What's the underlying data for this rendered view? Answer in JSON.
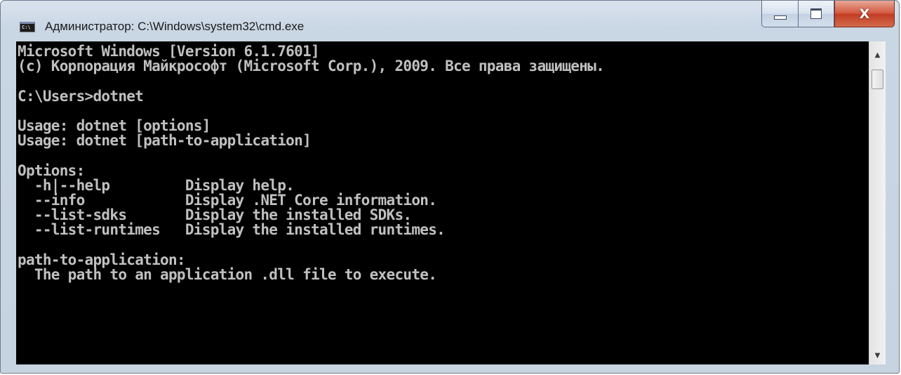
{
  "window": {
    "title": "Администратор: C:\\Windows\\system32\\cmd.exe",
    "icon": "cmd-console-icon",
    "icon_text": "C:\\",
    "buttons": {
      "minimize": "minimize-icon",
      "maximize": "maximize-icon",
      "close_glyph": "X"
    }
  },
  "console": {
    "lines": [
      "Microsoft Windows [Version 6.1.7601]",
      "(c) Корпорация Майкрософт (Microsoft Corp.), 2009. Все права защищены.",
      "",
      "C:\\Users>dotnet",
      "",
      "Usage: dotnet [options]",
      "Usage: dotnet [path-to-application]",
      "",
      "Options:",
      "  -h|--help         Display help.",
      "  --info            Display .NET Core information.",
      "  --list-sdks       Display the installed SDKs.",
      "  --list-runtimes   Display the installed runtimes.",
      "",
      "path-to-application:",
      "  The path to an application .dll file to execute."
    ]
  },
  "scrollbar": {
    "up_arrow": "▲",
    "down_arrow": "▼"
  }
}
